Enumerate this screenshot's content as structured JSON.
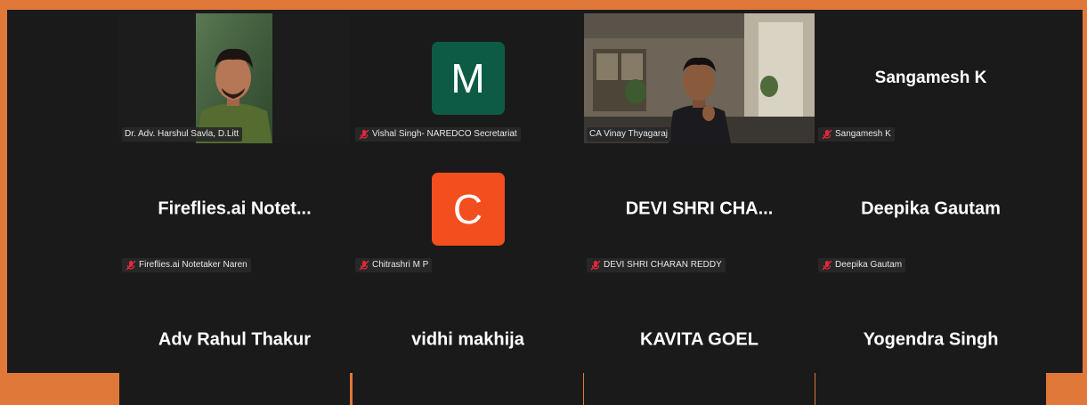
{
  "participants": [
    {
      "name": "Dr. Adv. Harshul Savla, D.Litt",
      "type": "video",
      "active": true,
      "muted": false
    },
    {
      "name": "Vishal Singh- NAREDCO Secretariat",
      "type": "avatar",
      "initial": "M",
      "avatar_color": "#0d5b44",
      "muted": true
    },
    {
      "name": "CA Vinay Thyagaraj",
      "type": "video",
      "muted": false
    },
    {
      "name": "Sangamesh K",
      "type": "name",
      "display": "Sangamesh K",
      "muted": true
    },
    {
      "name": "Fireflies.ai Notetaker Naren",
      "type": "name",
      "display": "Fireflies.ai  Notet...",
      "muted": true
    },
    {
      "name": "Chitrashri M P",
      "type": "avatar",
      "initial": "C",
      "avatar_color": "#f24e1e",
      "muted": true
    },
    {
      "name": "DEVI SHRI CHARAN REDDY",
      "type": "name",
      "display": "DEVI  SHRI  CHA...",
      "muted": true
    },
    {
      "name": "Deepika Gautam",
      "type": "name",
      "display": "Deepika Gautam",
      "muted": true
    },
    {
      "name": "",
      "type": "name",
      "display": "Adv Rahul Thakur"
    },
    {
      "name": "",
      "type": "name",
      "display": "vidhi makhija"
    },
    {
      "name": "",
      "type": "name",
      "display": "KAVITA GOEL"
    },
    {
      "name": "",
      "type": "name",
      "display": "Yogendra Singh"
    }
  ],
  "colors": {
    "active_border": "#3fd37b",
    "mute_icon": "#e0283c",
    "window_border": "#e0783a"
  }
}
